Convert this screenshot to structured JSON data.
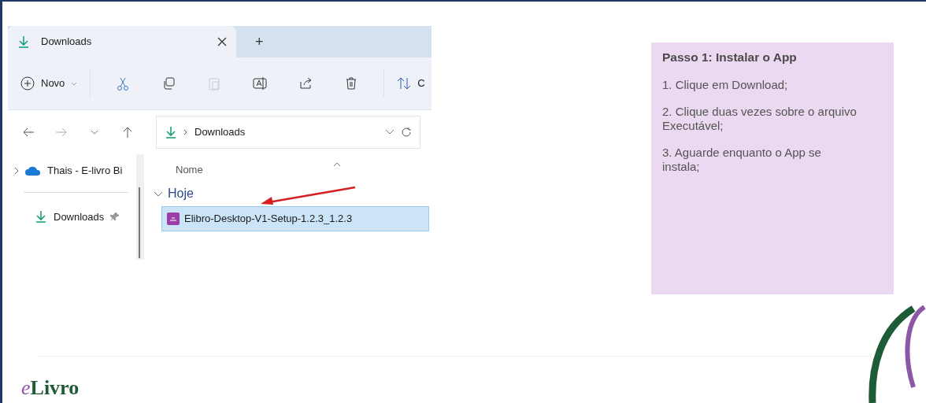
{
  "explorer": {
    "tabs": [
      {
        "label": "Downloads",
        "selected": true
      }
    ],
    "new_tab": "+",
    "toolbar": {
      "new_label": "Novo",
      "tools": [
        {
          "kind": "cut",
          "disabled": false
        },
        {
          "kind": "copy",
          "disabled": false
        },
        {
          "kind": "paste",
          "disabled": true
        },
        {
          "kind": "rename",
          "disabled": false
        },
        {
          "kind": "share",
          "disabled": false
        },
        {
          "kind": "delete",
          "disabled": false
        }
      ],
      "sort_label": "C"
    },
    "address": {
      "path": "Downloads"
    },
    "sidebar": {
      "items": [
        {
          "label": "Thais - E-livro Bi",
          "kind": "cloud",
          "pinned": false
        },
        {
          "label": "Downloads",
          "kind": "download",
          "pinned": true
        }
      ]
    },
    "list": {
      "column": "Nome",
      "groups": [
        {
          "label": "Hoje",
          "expanded": true,
          "files": [
            {
              "name": "Elibro-Desktop-V1-Setup-1.2.3_1.2.3",
              "selected": true
            }
          ]
        }
      ]
    }
  },
  "instructions": {
    "title": "Passo 1: Instalar o App",
    "steps": [
      "1. Clique em Download;",
      "2. Clique duas vezes sobre o arquivo Executável;",
      "3. Aguarde enquanto o App se instala;"
    ]
  },
  "footer": {
    "logo_mark": "e",
    "logo_text": "Livro"
  }
}
